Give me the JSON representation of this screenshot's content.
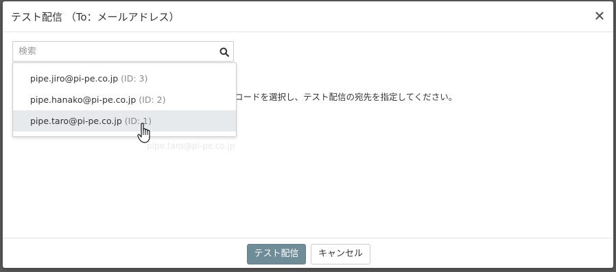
{
  "modal": {
    "title": "テスト配信 （To：メールアドレス）"
  },
  "search": {
    "placeholder": "検索",
    "value": ""
  },
  "background": {
    "hint_text": "コードを選択し、テスト配信の宛先を指定してください。",
    "faded_text": "pipe.taro@pi-pe.co.jp"
  },
  "dropdown": {
    "items": [
      {
        "email": "pipe.jiro@pi-pe.co.jp",
        "id_label": "(ID: 3)",
        "active": false
      },
      {
        "email": "pipe.hanako@pi-pe.co.jp",
        "id_label": "(ID: 2)",
        "active": false
      },
      {
        "email": "pipe.taro@pi-pe.co.jp",
        "id_label": "(ID: 1)",
        "active": true
      }
    ]
  },
  "footer": {
    "submit_label": "テスト配信",
    "cancel_label": "キャンセル"
  },
  "colors": {
    "primary_button": "#6f8c99",
    "active_item": "#e7eaec",
    "backdrop": "#5a5a5a"
  }
}
